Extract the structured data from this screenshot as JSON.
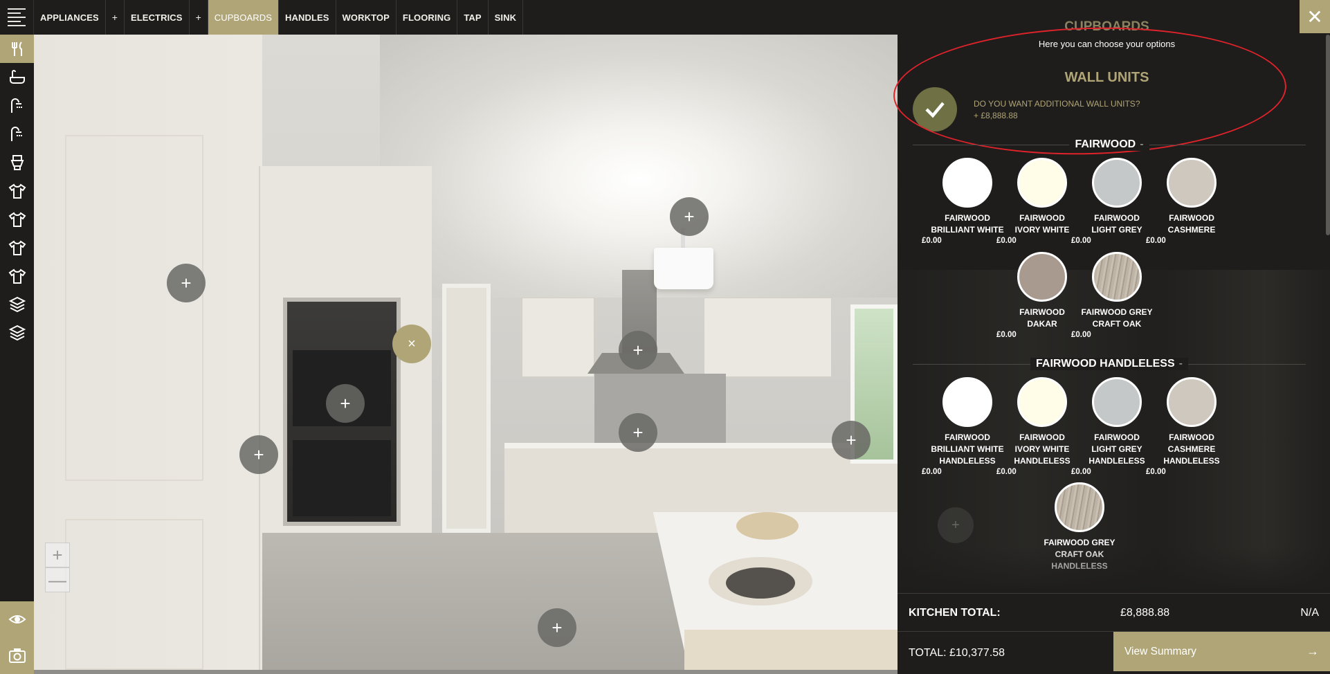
{
  "nav": {
    "items": [
      {
        "label": "APPLIANCES",
        "type": "item"
      },
      {
        "label": "+",
        "type": "plus"
      },
      {
        "label": "ELECTRICS",
        "type": "item"
      },
      {
        "label": "+",
        "type": "plus"
      },
      {
        "label": "CUPBOARDS",
        "type": "item",
        "active": true
      },
      {
        "label": "HANDLES",
        "type": "item"
      },
      {
        "label": "WORKTOP",
        "type": "item"
      },
      {
        "label": "FLOORING",
        "type": "item"
      },
      {
        "label": "TAP",
        "type": "item"
      },
      {
        "label": "SINK",
        "type": "item"
      }
    ]
  },
  "rail": {
    "icons": [
      "cutlery-icon",
      "bath-icon",
      "shower-icon",
      "shower-icon",
      "toilet-icon",
      "shirt-icon",
      "shirt-icon",
      "shirt-icon",
      "shirt-icon",
      "layers-icon",
      "layers-icon"
    ],
    "bottom_icons": [
      "eye-icon",
      "camera-icon"
    ]
  },
  "scene": {
    "zoom_in": "+",
    "zoom_out": "—",
    "hotspot_symbol": "+",
    "close_symbol": "×"
  },
  "panel": {
    "close": "✕",
    "title": "CUPBOARDS",
    "subtitle": "Here you can choose your options",
    "section_title": "WALL UNITS",
    "question": "DO YOU WANT ADDITIONAL WALL UNITS?",
    "question_price": "+ £8,888.88",
    "groups": [
      {
        "title": "FAIRWOOD",
        "dash": "-",
        "swatches": [
          {
            "name": [
              "FAIRWOOD",
              "BRILLIANT WHITE"
            ],
            "price": "£0.00",
            "color": "#ffffff"
          },
          {
            "name": [
              "FAIRWOOD",
              "IVORY WHITE"
            ],
            "price": "£0.00",
            "color": "#fffce8"
          },
          {
            "name": [
              "FAIRWOOD",
              "LIGHT GREY"
            ],
            "price": "£0.00",
            "color": "#c5c8c8"
          },
          {
            "name": [
              "FAIRWOOD",
              "CASHMERE"
            ],
            "price": "£0.00",
            "color": "#cfc8bf"
          },
          {
            "name": [
              "FAIRWOOD",
              "DAKAR"
            ],
            "price": "£0.00",
            "color": "#a89a8e"
          },
          {
            "name": [
              "FAIRWOOD GREY",
              "CRAFT OAK"
            ],
            "price": "£0.00",
            "color": "#b7aea1"
          }
        ]
      },
      {
        "title": "FAIRWOOD HANDLELESS",
        "dash": "-",
        "swatches": [
          {
            "name": [
              "FAIRWOOD",
              "BRILLIANT WHITE",
              "HANDLELESS"
            ],
            "price": "£0.00",
            "color": "#ffffff"
          },
          {
            "name": [
              "FAIRWOOD",
              "IVORY WHITE",
              "HANDLELESS"
            ],
            "price": "£0.00",
            "color": "#fffce8"
          },
          {
            "name": [
              "FAIRWOOD",
              "LIGHT GREY",
              "HANDLELESS"
            ],
            "price": "£0.00",
            "color": "#c5c8c8"
          },
          {
            "name": [
              "FAIRWOOD",
              "CASHMERE",
              "HANDLELESS"
            ],
            "price": "£0.00",
            "color": "#cfc8bf"
          },
          {
            "name": [
              "FAIRWOOD GREY",
              "CRAFT OAK",
              "HANDLELESS"
            ],
            "price": "",
            "color": "#b7aea1"
          }
        ]
      }
    ],
    "kitchen_total_label": "KITCHEN TOTAL:",
    "kitchen_total_value": "£8,888.88",
    "kitchen_total_na": "N/A",
    "total_label": "TOTAL: £10,377.58",
    "view_summary": "View Summary",
    "arrow": "→"
  },
  "colors": {
    "accent": "#b0a577",
    "dark": "#1e1d1b",
    "check": "#6f7044",
    "annotation": "#e0232b"
  }
}
